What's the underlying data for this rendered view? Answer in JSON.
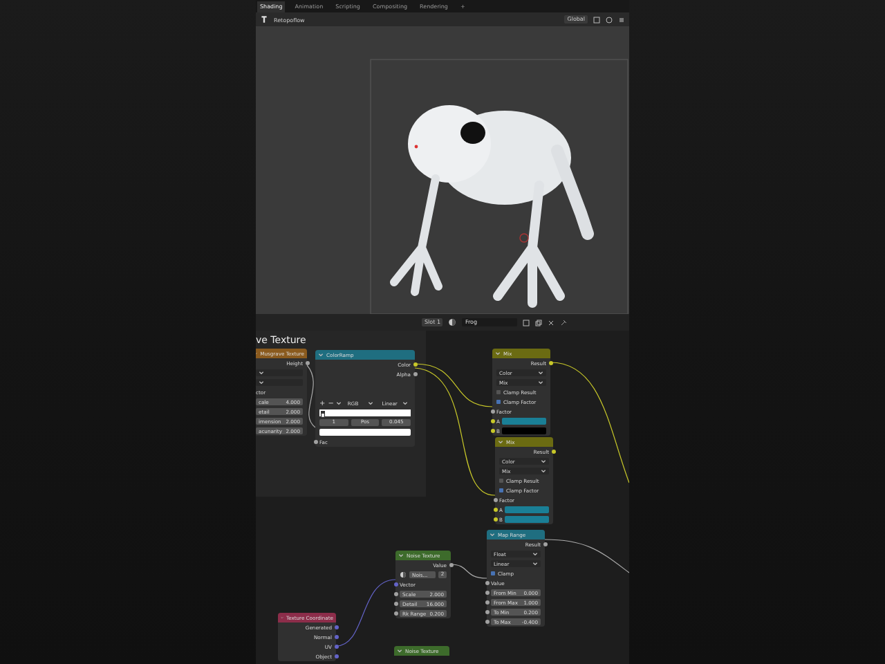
{
  "workspace_tabs": [
    {
      "label": "Shading",
      "selected": true
    },
    {
      "label": "Animation",
      "selected": false
    },
    {
      "label": "Scripting",
      "selected": false
    },
    {
      "label": "Compositing",
      "selected": false
    },
    {
      "label": "Rendering",
      "selected": false
    },
    {
      "label": "+",
      "selected": false
    }
  ],
  "viewport_header": {
    "addon": "Retopoflow",
    "orientation": "Global"
  },
  "node_header": {
    "slot": "Slot 1",
    "material": "Frog"
  },
  "frame_label": "ve Texture",
  "nodes": [
    {
      "title": "Musgrave Texture",
      "color": "#8a5a1e",
      "rows": [
        {
          "kind": "output",
          "label": "Height",
          "color": "#a1a1a1"
        },
        {
          "kind": "dropdown"
        },
        {
          "kind": "dropdown"
        },
        {
          "kind": "input",
          "label": "ctor"
        },
        {
          "kind": "field",
          "label": "cale",
          "value": "4.000"
        },
        {
          "kind": "field",
          "label": "etail",
          "value": "2.000"
        },
        {
          "kind": "field",
          "label": "imension",
          "value": "2.000"
        },
        {
          "kind": "field",
          "label": "acunarity",
          "value": "2.000"
        }
      ]
    },
    {
      "title": "ColorRamp",
      "color": "#1f6e80",
      "rows": [
        {
          "kind": "output",
          "label": "Color",
          "color": "#c7c729"
        },
        {
          "kind": "output",
          "label": "Alpha",
          "color": "#a1a1a1"
        },
        {
          "kind": "spacer"
        },
        {
          "kind": "ramp_controls",
          "items": [
            "+",
            "−"
          ],
          "modes": [
            "RGB",
            "Linear"
          ]
        },
        {
          "kind": "ramp"
        },
        {
          "kind": "ramp_stop",
          "items": [
            "1",
            "Pos",
            "0.045"
          ]
        },
        {
          "kind": "swatch",
          "color": "#ffffff"
        },
        {
          "kind": "input",
          "label": "Fac",
          "color": "#a1a1a1"
        }
      ]
    },
    {
      "title": "Mix",
      "color": "#6b6b12",
      "rows": [
        {
          "kind": "output",
          "label": "Result",
          "color": "#c7c729"
        },
        {
          "kind": "dropdown",
          "label": "Color"
        },
        {
          "kind": "dropdown",
          "label": "Mix"
        },
        {
          "kind": "checkbox",
          "label": "Clamp Result",
          "checked": false
        },
        {
          "kind": "checkbox",
          "label": "Clamp Factor",
          "checked": true
        },
        {
          "kind": "input",
          "label": "Factor",
          "color": "#a1a1a1"
        },
        {
          "kind": "swatch",
          "label": "A",
          "color": "#1a7f96"
        },
        {
          "kind": "swatch",
          "label": "B",
          "color": "#000000"
        }
      ]
    },
    {
      "title": "Mix",
      "color": "#6b6b12",
      "rows": [
        {
          "kind": "output",
          "label": "Result",
          "color": "#c7c729"
        },
        {
          "kind": "dropdown",
          "label": "Color"
        },
        {
          "kind": "dropdown",
          "label": "Mix"
        },
        {
          "kind": "checkbox",
          "label": "Clamp Result",
          "checked": false
        },
        {
          "kind": "checkbox",
          "label": "Clamp Factor",
          "checked": true
        },
        {
          "kind": "input",
          "label": "Factor",
          "color": "#a1a1a1"
        },
        {
          "kind": "swatch",
          "label": "A",
          "color": "#1a7f96"
        },
        {
          "kind": "swatch",
          "label": "B",
          "color": "#1a7f96"
        }
      ]
    },
    {
      "title": "Map Range",
      "color": "#1f6e80",
      "rows": [
        {
          "kind": "output",
          "label": "Result",
          "color": "#a1a1a1"
        },
        {
          "kind": "dropdown",
          "label": "Float"
        },
        {
          "kind": "dropdown",
          "label": "Linear"
        },
        {
          "kind": "checkbox",
          "label": "Clamp",
          "checked": true
        },
        {
          "kind": "input",
          "label": "Value",
          "color": "#a1a1a1"
        },
        {
          "kind": "field",
          "label": "From Min",
          "value": "0.000"
        },
        {
          "kind": "field",
          "label": "From Max",
          "value": "1.000"
        },
        {
          "kind": "field",
          "label": "To Min",
          "value": "0.200"
        },
        {
          "kind": "field",
          "label": "To Max",
          "value": "-0.400"
        }
      ]
    },
    {
      "title": "Noise Texture",
      "color": "#3d6b2b",
      "rows": [
        {
          "kind": "output",
          "label": "Value",
          "color": "#a1a1a1"
        },
        {
          "kind": "texture_select",
          "label": "Nois...",
          "value": "2"
        },
        {
          "kind": "input",
          "label": "Vector",
          "color": "#6363c7"
        },
        {
          "kind": "field",
          "label": "Scale",
          "value": "2.000"
        },
        {
          "kind": "field",
          "label": "Detail",
          "value": "16.000"
        },
        {
          "kind": "field",
          "label": "Rk Range",
          "value": "0.200"
        }
      ]
    },
    {
      "title": "Texture Coordinate",
      "color": "#8c2d4a",
      "rows": [
        {
          "kind": "output",
          "label": "Generated",
          "color": "#6363c7"
        },
        {
          "kind": "output",
          "label": "Normal",
          "color": "#6363c7"
        },
        {
          "kind": "output",
          "label": "UV",
          "color": "#6363c7"
        },
        {
          "kind": "output",
          "label": "Object",
          "color": "#6363c7"
        }
      ]
    },
    {
      "title": "Noise Texture",
      "color": "#3d6b2b"
    }
  ]
}
